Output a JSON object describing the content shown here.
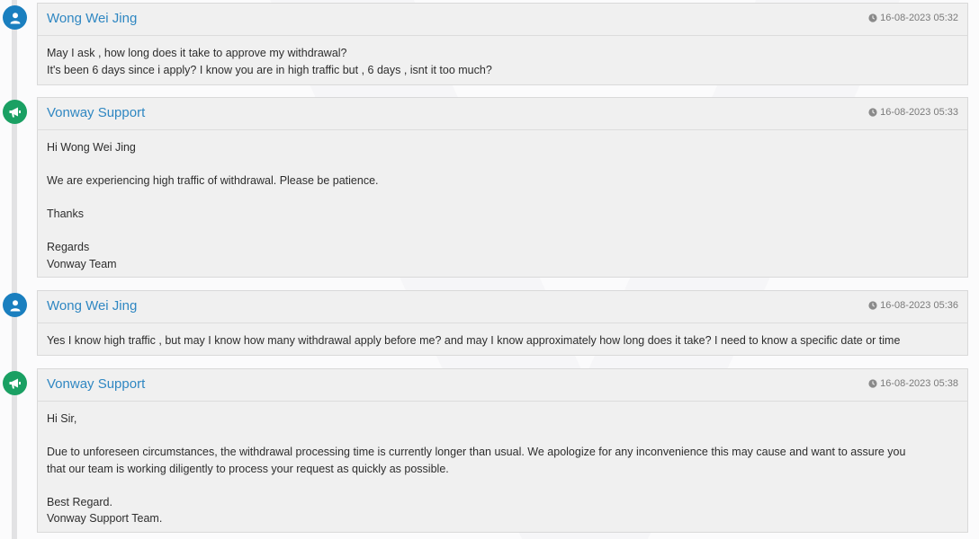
{
  "messages": [
    {
      "author": "Wong Wei Jing",
      "role": "user",
      "timestamp": "16-08-2023 05:32",
      "lines": [
        "May I ask , how long does it take to approve my withdrawal?",
        "It's been 6 days since i apply? I know you are in high traffic but , 6 days , isnt it too much?"
      ]
    },
    {
      "author": "Vonway Support",
      "role": "support",
      "timestamp": "16-08-2023 05:33",
      "lines": [
        "Hi Wong Wei Jing",
        "",
        "We are experiencing high traffic of withdrawal. Please be patience.",
        "",
        "Thanks",
        "",
        "Regards",
        "Vonway Team"
      ]
    },
    {
      "author": "Wong Wei Jing",
      "role": "user",
      "timestamp": "16-08-2023 05:36",
      "lines": [
        "Yes I know high traffic , but may I know how many withdrawal apply before me? and may I know approximately how long does it take? I need to know a specific date or time"
      ]
    },
    {
      "author": "Vonway Support",
      "role": "support",
      "timestamp": "16-08-2023 05:38",
      "lines": [
        "Hi Sir,",
        "",
        "Due to unforeseen circumstances, the withdrawal processing time is currently longer than usual. We apologize for any inconvenience this may cause and want to assure you",
        "that our team is working diligently to process your request as quickly as possible.",
        "",
        "Best Regard.",
        "Vonway Support Team."
      ]
    }
  ],
  "icons": {
    "user": "user-icon",
    "support": "megaphone-icon",
    "time": "clock-icon"
  },
  "colors": {
    "author": "#2f87c2",
    "user_avatar": "#1a7fbf",
    "support_avatar": "#1aa063"
  }
}
